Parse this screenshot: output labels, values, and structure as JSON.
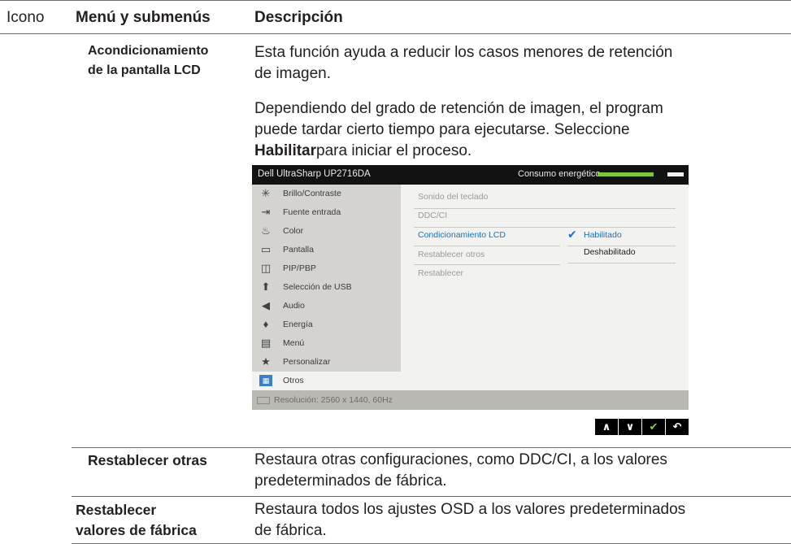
{
  "header": {
    "col_icon": "Icono",
    "col_menu": "Menú y submenús",
    "col_desc": "Descripción"
  },
  "rows": [
    {
      "name": "Acondicionamiento de la pantalla LCD",
      "name_line1": "Acondicionamiento",
      "name_line2": "de la pantalla LCD",
      "desc_p1_line1": "Esta función ayuda a reducir los casos menores de retención",
      "desc_p1_line2": "de imagen.",
      "desc_p2_line1": "Dependiendo del grado de retención de imagen, el program",
      "desc_p2_line2": "puede tardar cierto tiempo para ejecutarse. Seleccione",
      "desc_p2_bold": "Habilitar",
      "desc_p2_tail": "para iniciar el proceso."
    },
    {
      "name": "Restablecer otras",
      "desc_line1": "Restaura otras configuraciones, como DDC/CI, a los valores",
      "desc_line2": "predeterminados de fábrica."
    },
    {
      "name_line1": "Restablecer",
      "name_line2": "valores de fábrica",
      "desc_line1": "Restaura todos los ajustes OSD a los valores predeterminados",
      "desc_line2": "de fábrica."
    }
  ],
  "osd": {
    "model": "Dell UltraSharp UP2716DA",
    "energy_label": "Consumo energético",
    "energy_level": 0.8,
    "menu": [
      {
        "label": "Brillo/Contraste",
        "icon": "sun-icon",
        "glyph": "✳"
      },
      {
        "label": "Fuente entrada",
        "icon": "input-source-icon",
        "glyph": "⇥"
      },
      {
        "label": "Color",
        "icon": "color-icon",
        "glyph": "♨"
      },
      {
        "label": "Pantalla",
        "icon": "display-icon",
        "glyph": "▭"
      },
      {
        "label": "PIP/PBP",
        "icon": "pip-icon",
        "glyph": "◫"
      },
      {
        "label": "Selección de USB",
        "icon": "usb-icon",
        "glyph": "⬆"
      },
      {
        "label": "Audio",
        "icon": "speaker-icon",
        "glyph": "◀"
      },
      {
        "label": "Energía",
        "icon": "energy-icon",
        "glyph": "♦"
      },
      {
        "label": "Menú",
        "icon": "menu-icon",
        "glyph": "▤"
      },
      {
        "label": "Personalizar",
        "icon": "star-icon",
        "glyph": "★"
      },
      {
        "label": "Otros",
        "icon": "others-icon",
        "glyph": "▦"
      }
    ],
    "selected_menu": "Otros",
    "submenu": [
      "Sonido del teclado",
      "DDC/CI",
      "Condicionamiento LCD",
      "Restablecer otros",
      "Restablecer"
    ],
    "active_submenu": "Condicionamiento LCD",
    "options": {
      "enabled": "Habilitado",
      "disabled": "Deshabilitado",
      "selected": "Habilitado"
    },
    "footer": "Resolución: 2560 x 1440, 60Hz"
  },
  "nav_buttons": [
    {
      "name": "up-button",
      "icon": "chevron-up-icon",
      "glyph": "∧"
    },
    {
      "name": "down-button",
      "icon": "chevron-down-icon",
      "glyph": "∨"
    },
    {
      "name": "confirm-button",
      "icon": "check-icon",
      "glyph": "✔"
    },
    {
      "name": "back-button",
      "icon": "back-icon",
      "glyph": "↶"
    }
  ]
}
